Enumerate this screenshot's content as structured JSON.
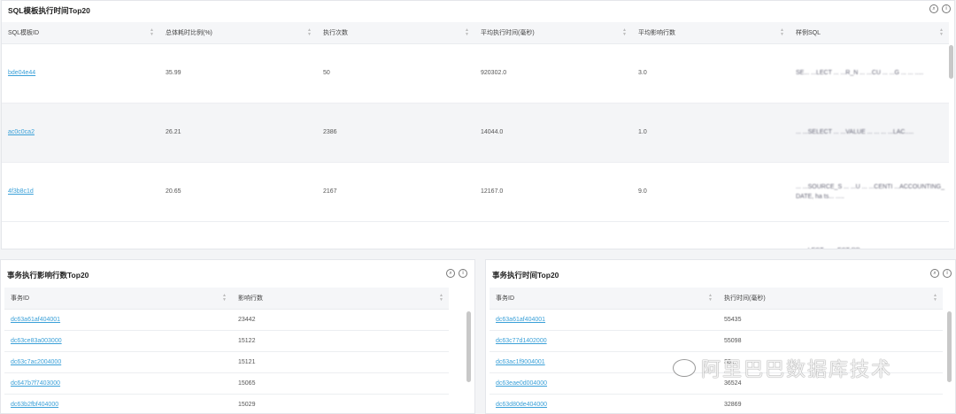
{
  "sql_top": {
    "title": "SQL模板执行时间Top20",
    "columns": [
      "SQL模板ID",
      "总体耗时比例(%)",
      "执行次数",
      "平均执行时间(毫秒)",
      "平均影响行数",
      "样例SQL"
    ],
    "rows": [
      {
        "id": "bde04e44",
        "pct": "35.99",
        "count": "50",
        "avg_time": "920302.0",
        "avg_rows": "3.0",
        "sql": "SE... ...LECT ... ...R_N ... ...CU ... ...G ... ... .....",
        "alt": false
      },
      {
        "id": "ac0c0ca2",
        "pct": "26.21",
        "count": "2386",
        "avg_time": "14044.0",
        "avg_rows": "1.0",
        "sql": "... ...SELECT ... ...VALUE ... ... ... ...LAC.....",
        "alt": true
      },
      {
        "id": "4f3b8c1d",
        "pct": "20.65",
        "count": "2167",
        "avg_time": "12167.0",
        "avg_rows": "9.0",
        "sql": "... ...SOURCE_S ... ...U ... ...CENTI ...ACCOUNTING_DATE, ha ts... .....",
        "alt": false
      },
      {
        "id": "",
        "pct": "",
        "count": "",
        "avg_time": "",
        "avg_rows": "",
        "sql": "... ...LECT ... ...ECT RP",
        "alt": false
      }
    ]
  },
  "trx_rows": {
    "title": "事务执行影响行数Top20",
    "columns": [
      "事务ID",
      "影响行数"
    ],
    "rows": [
      [
        "dc63a61af404001",
        "23442"
      ],
      [
        "dc63ce83a003000",
        "15122"
      ],
      [
        "dc63c7ac2004000",
        "15121"
      ],
      [
        "dc647b7f7403000",
        "15065"
      ],
      [
        "dc63b2fbf404000",
        "15029"
      ]
    ]
  },
  "trx_time": {
    "title": "事务执行时间Top20",
    "columns": [
      "事务ID",
      "执行时间(毫秒)"
    ],
    "rows": [
      [
        "dc63a61af404001",
        "55435"
      ],
      [
        "dc63c77d1402000",
        "55098"
      ],
      [
        "dc63ac1f9004001",
        "38..."
      ],
      [
        "dc63eae0d004000",
        "36524"
      ],
      [
        "dc63d80de404000",
        "32869"
      ]
    ]
  },
  "watermark": "阿里巴巴数据库技术"
}
